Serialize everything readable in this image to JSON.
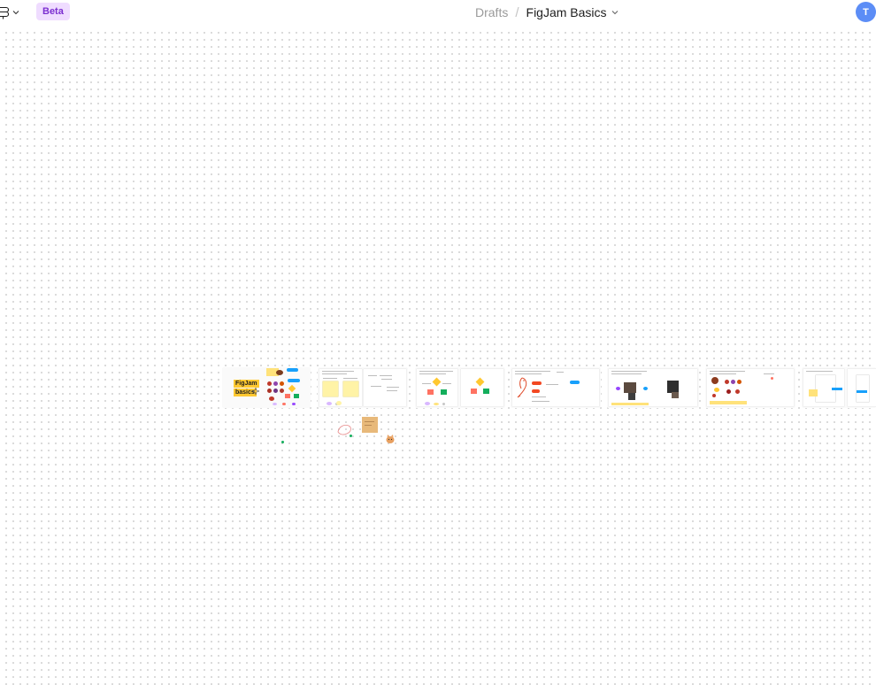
{
  "header": {
    "beta_label": "Beta",
    "breadcrumb_parent": "Drafts",
    "breadcrumb_separator": "/",
    "file_name": "FigJam Basics",
    "avatar_initial": "T"
  },
  "board": {
    "title_sticker_line1": "FigJam",
    "title_sticker_line2": "basics"
  },
  "colors": {
    "accent": "#5c8df6",
    "beta_bg": "#efdcff",
    "beta_text": "#7b2fd0",
    "sticky_yellow": "#fff3a6",
    "sticker_orange": "#ffc830",
    "shape_red": "#f24822",
    "shape_green": "#14ae5c",
    "shape_blue": "#18a0fb",
    "shape_purple": "#d9b8ff"
  },
  "icons": {
    "main_menu": "figma-logo-icon",
    "menu_caret": "chevron-down-icon",
    "file_caret": "chevron-down-icon"
  }
}
